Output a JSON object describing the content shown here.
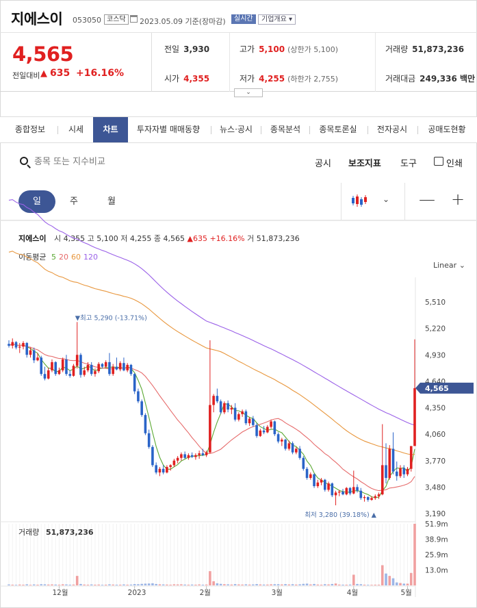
{
  "header": {
    "name": "지에스이",
    "code": "053050",
    "market": "코스닥",
    "date_label": "2023.05.09  기준(장마감)",
    "realtime_label": "실시간",
    "corp_info_label": "기업개요 ▾"
  },
  "quote": {
    "price": "4,565",
    "change_label": "전일대비",
    "change_arrow": "▲",
    "change": "635",
    "change_pct": "+16.16%",
    "prev_close_label": "전일",
    "prev_close": "3,930",
    "open_label": "시가",
    "open": "4,355",
    "high_label": "고가",
    "high": "5,100",
    "high_limit": "(상한가 5,100)",
    "low_label": "저가",
    "low": "4,255",
    "low_limit": "(하한가 2,755)",
    "volume_label": "거래량",
    "volume": "51,873,236",
    "value_label": "거래대금",
    "value": "249,336 백만"
  },
  "expander_label": "⌄",
  "tabs": [
    "종합정보",
    "시세",
    "차트",
    "투자자별 매매동향",
    "뉴스·공시",
    "종목분석",
    "종목토론실",
    "전자공시",
    "공매도현황"
  ],
  "active_tab": "차트",
  "toolbar": {
    "search_placeholder": "종목 또는 지수비교",
    "notice": "공시",
    "indicator": "보조지표",
    "tools": "도구",
    "print": "인쇄"
  },
  "periods": [
    "일",
    "주",
    "월"
  ],
  "zoom": {
    "out": "—",
    "in": "+"
  },
  "chart_info": {
    "name": "지에스이",
    "open_label": "시",
    "open": "4,355",
    "high_label": "고",
    "high": "5,100",
    "low_label": "저",
    "low": "4,255",
    "close_label": "종",
    "close": "4,565",
    "change": "▲635",
    "pct": "+16.16%",
    "volume_label": "거",
    "volume": "51,873,236",
    "ma_label": "이동평균",
    "ma": [
      {
        "label": "5",
        "color": "#5aa832"
      },
      {
        "label": "20",
        "color": "#e66a6a"
      },
      {
        "label": "60",
        "color": "#e8963c"
      },
      {
        "label": "120",
        "color": "#9a60e8"
      }
    ],
    "scale": "Linear"
  },
  "colors": {
    "accent": "#3d5695",
    "up": "#e02020",
    "down": "#2a64c8"
  },
  "chart_data": {
    "type": "candlestick",
    "title": "지에스이",
    "ylim": [
      3190,
      5510
    ],
    "y_ticks": [
      "5,510",
      "5,220",
      "4,930",
      "4,640",
      "4,350",
      "4,060",
      "3,770",
      "3,480",
      "3,190"
    ],
    "x_ticks": [
      "12월",
      "2023",
      "2월",
      "3월",
      "4월",
      "5월"
    ],
    "last_price_tag": "4,565",
    "max_annotation": "▼최고 5,290 (-13.71%)",
    "min_annotation": "최저 3,280 (39.18%) ▲",
    "volume_label": "거래량",
    "volume_total": "51,873,236",
    "volume_ticks": [
      "51.9m",
      "38.9m",
      "25.9m",
      "13.0m"
    ],
    "ohlc": [
      [
        5050,
        5090,
        5010,
        5030
      ],
      [
        5030,
        5110,
        5000,
        5070
      ],
      [
        5070,
        5080,
        4990,
        5010
      ],
      [
        5010,
        5060,
        4950,
        5020
      ],
      [
        5020,
        5080,
        4990,
        5060
      ],
      [
        5060,
        5070,
        4900,
        4930
      ],
      [
        4930,
        5010,
        4900,
        4980
      ],
      [
        4980,
        5010,
        4840,
        4870
      ],
      [
        4870,
        4950,
        4860,
        4900
      ],
      [
        4900,
        4920,
        4700,
        4720
      ],
      [
        4720,
        4800,
        4650,
        4670
      ],
      [
        4670,
        4790,
        4660,
        4760
      ],
      [
        4760,
        4880,
        4740,
        4850
      ],
      [
        4850,
        4860,
        4700,
        4720
      ],
      [
        4720,
        4790,
        4710,
        4760
      ],
      [
        4760,
        4900,
        4740,
        4880
      ],
      [
        4880,
        4930,
        4700,
        4720
      ],
      [
        4720,
        4760,
        4680,
        4700
      ],
      [
        4700,
        4830,
        4690,
        4810
      ],
      [
        4810,
        5290,
        4780,
        4930
      ],
      [
        4930,
        4950,
        4680,
        4710
      ],
      [
        4710,
        4800,
        4690,
        4760
      ],
      [
        4760,
        4850,
        4740,
        4820
      ],
      [
        4820,
        4850,
        4700,
        4720
      ],
      [
        4720,
        4780,
        4690,
        4750
      ],
      [
        4750,
        4850,
        4730,
        4830
      ],
      [
        4830,
        4840,
        4780,
        4800
      ],
      [
        4800,
        4870,
        4780,
        4850
      ],
      [
        4850,
        4950,
        4700,
        4720
      ],
      [
        4720,
        4830,
        4700,
        4800
      ],
      [
        4800,
        4900,
        4760,
        4770
      ],
      [
        4770,
        4860,
        4750,
        4840
      ],
      [
        4840,
        4900,
        4750,
        4760
      ],
      [
        4760,
        4840,
        4740,
        4820
      ],
      [
        4820,
        4830,
        4700,
        4720
      ],
      [
        4720,
        4730,
        4500,
        4530
      ],
      [
        4530,
        4560,
        4400,
        4420
      ],
      [
        4420,
        4440,
        4250,
        4270
      ],
      [
        4270,
        4290,
        4050,
        4070
      ],
      [
        4070,
        4110,
        3900,
        3920
      ],
      [
        3920,
        3940,
        3700,
        3720
      ],
      [
        3720,
        3750,
        3620,
        3640
      ],
      [
        3640,
        3700,
        3600,
        3680
      ],
      [
        3680,
        3720,
        3620,
        3640
      ],
      [
        3640,
        3720,
        3630,
        3700
      ],
      [
        3700,
        3730,
        3660,
        3720
      ],
      [
        3720,
        3790,
        3700,
        3770
      ],
      [
        3770,
        3820,
        3740,
        3800
      ],
      [
        3800,
        3860,
        3770,
        3840
      ],
      [
        3840,
        3870,
        3790,
        3800
      ],
      [
        3800,
        3850,
        3780,
        3830
      ],
      [
        3830,
        3860,
        3800,
        3810
      ],
      [
        3810,
        3850,
        3780,
        3830
      ],
      [
        3830,
        3880,
        3790,
        3850
      ],
      [
        3850,
        3900,
        3820,
        3830
      ],
      [
        3830,
        3880,
        3810,
        3860
      ],
      [
        3860,
        5090,
        3850,
        4380
      ],
      [
        4380,
        4500,
        4300,
        4480
      ],
      [
        4480,
        4560,
        4400,
        4420
      ],
      [
        4420,
        4440,
        4280,
        4300
      ],
      [
        4300,
        4420,
        4280,
        4400
      ],
      [
        4400,
        4430,
        4300,
        4330
      ],
      [
        4330,
        4380,
        4280,
        4350
      ],
      [
        4350,
        4400,
        4200,
        4220
      ],
      [
        4220,
        4300,
        4200,
        4280
      ],
      [
        4280,
        4330,
        4250,
        4310
      ],
      [
        4310,
        4330,
        4160,
        4180
      ],
      [
        4180,
        4250,
        4150,
        4230
      ],
      [
        4230,
        4260,
        4140,
        4160
      ],
      [
        4160,
        4180,
        4020,
        4040
      ],
      [
        4040,
        4120,
        4030,
        4100
      ],
      [
        4100,
        4150,
        4060,
        4080
      ],
      [
        4080,
        4160,
        4070,
        4140
      ],
      [
        4140,
        4220,
        4120,
        4200
      ],
      [
        4200,
        4210,
        4040,
        4060
      ],
      [
        4060,
        4080,
        3960,
        3980
      ],
      [
        3980,
        4020,
        3930,
        4000
      ],
      [
        4000,
        4010,
        3880,
        3900
      ],
      [
        3900,
        3990,
        3880,
        3960
      ],
      [
        3960,
        3980,
        3840,
        3860
      ],
      [
        3860,
        3920,
        3840,
        3900
      ],
      [
        3900,
        3930,
        3780,
        3800
      ],
      [
        3800,
        3820,
        3660,
        3680
      ],
      [
        3680,
        3700,
        3560,
        3580
      ],
      [
        3580,
        3640,
        3560,
        3620
      ],
      [
        3620,
        3630,
        3470,
        3490
      ],
      [
        3490,
        3560,
        3470,
        3530
      ],
      [
        3530,
        3580,
        3500,
        3560
      ],
      [
        3560,
        3570,
        3430,
        3450
      ],
      [
        3450,
        3540,
        3430,
        3520
      ],
      [
        3520,
        3530,
        3370,
        3390
      ],
      [
        3390,
        3440,
        3280,
        3420
      ],
      [
        3420,
        3450,
        3380,
        3430
      ],
      [
        3430,
        3460,
        3390,
        3400
      ],
      [
        3400,
        3480,
        3390,
        3470
      ],
      [
        3470,
        3480,
        3390,
        3410
      ],
      [
        3410,
        3660,
        3400,
        3480
      ],
      [
        3480,
        3510,
        3420,
        3440
      ],
      [
        3440,
        3470,
        3340,
        3360
      ],
      [
        3360,
        3390,
        3320,
        3370
      ],
      [
        3370,
        3380,
        3320,
        3340
      ],
      [
        3340,
        3380,
        3330,
        3360
      ],
      [
        3360,
        3400,
        3340,
        3380
      ],
      [
        3380,
        3420,
        3350,
        3400
      ],
      [
        3400,
        4170,
        3390,
        3720
      ],
      [
        3720,
        3960,
        3520,
        3580
      ],
      [
        3580,
        3940,
        3560,
        3900
      ],
      [
        3900,
        4080,
        3620,
        3650
      ],
      [
        3650,
        3760,
        3550,
        3600
      ],
      [
        3600,
        3720,
        3580,
        3690
      ],
      [
        3690,
        3720,
        3580,
        3620
      ],
      [
        3620,
        3700,
        3600,
        3680
      ],
      [
        3680,
        3920,
        3650,
        3930
      ],
      [
        3930,
        5100,
        4255,
        4565
      ]
    ],
    "volumes_m": [
      0.8,
      0.6,
      0.5,
      0.7,
      0.6,
      0.9,
      0.5,
      0.8,
      0.6,
      1.0,
      0.9,
      0.7,
      0.8,
      0.7,
      0.6,
      0.9,
      0.8,
      0.6,
      0.7,
      8.0,
      1.2,
      0.7,
      0.6,
      0.8,
      0.6,
      0.7,
      0.5,
      0.6,
      0.9,
      0.7,
      0.6,
      0.6,
      0.8,
      0.6,
      0.7,
      1.1,
      1.0,
      1.3,
      1.5,
      1.6,
      1.8,
      1.2,
      0.9,
      0.8,
      0.7,
      0.6,
      0.9,
      0.8,
      0.9,
      0.7,
      0.6,
      0.7,
      0.6,
      0.8,
      0.6,
      0.7,
      12.0,
      3.5,
      1.8,
      1.3,
      1.0,
      0.9,
      0.7,
      1.1,
      0.8,
      0.7,
      0.9,
      0.7,
      0.8,
      1.1,
      0.8,
      0.7,
      0.7,
      0.9,
      1.0,
      1.0,
      0.8,
      1.1,
      0.8,
      1.0,
      0.7,
      0.9,
      1.3,
      1.5,
      0.8,
      1.2,
      0.7,
      0.6,
      1.0,
      0.8,
      1.2,
      1.6,
      0.7,
      0.6,
      0.6,
      0.7,
      9.0,
      1.2,
      1.0,
      0.6,
      0.5,
      0.5,
      0.6,
      0.6,
      17.0,
      10.0,
      8.0,
      6.0,
      2.5,
      2.0,
      1.5,
      1.5,
      10.5,
      51.9
    ]
  }
}
